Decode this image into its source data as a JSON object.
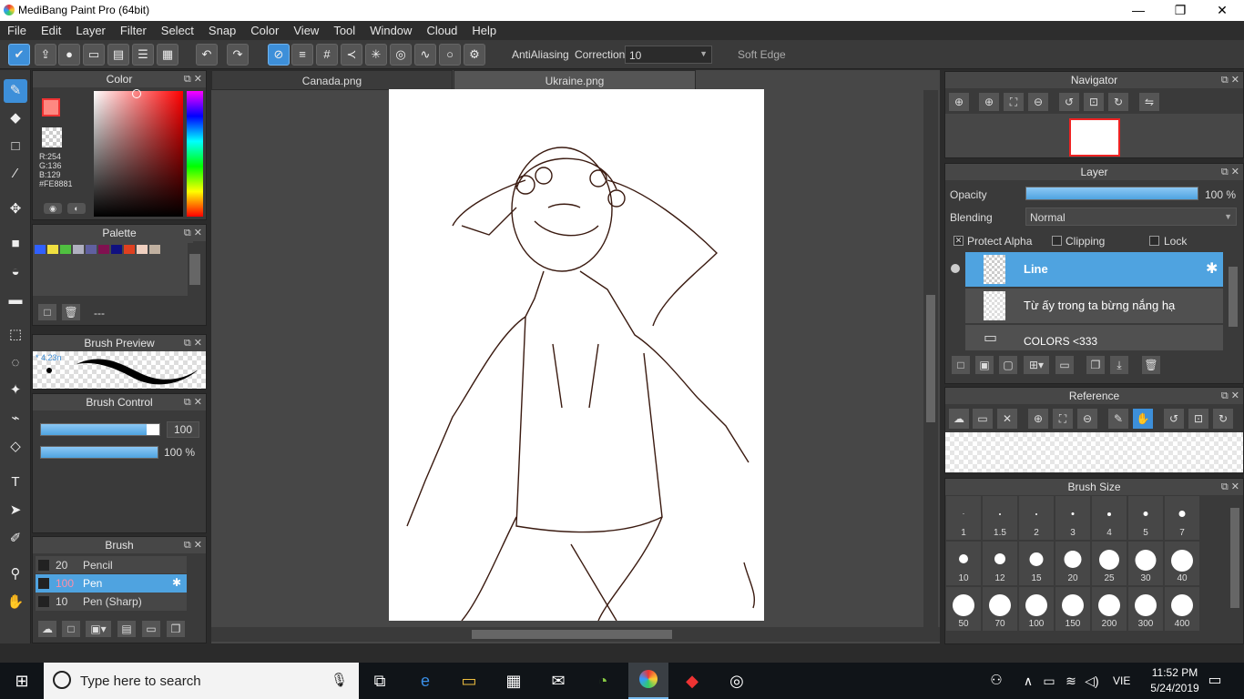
{
  "window": {
    "title": "MediBang Paint Pro (64bit)",
    "minimize": "—",
    "restore": "❐",
    "close": "✕"
  },
  "menu": [
    "File",
    "Edit",
    "Layer",
    "Filter",
    "Select",
    "Snap",
    "Color",
    "View",
    "Tool",
    "Window",
    "Cloud",
    "Help"
  ],
  "toolbar": {
    "antialiasing_label": "AntiAliasing",
    "antialiasing_checked": "✕",
    "correction_label": "Correction",
    "correction_value": "10",
    "soft_edge_label": "Soft Edge"
  },
  "color_panel": {
    "title": "Color",
    "r": "R:254",
    "g": "G:136",
    "b": "B:129",
    "hex": "#FE8881",
    "primary": "#fe8881",
    "secondary": "#fe8881"
  },
  "palette": {
    "title": "Palette",
    "colors": [
      "#3060ff",
      "#f0e040",
      "#50c040",
      "#b0b0c0",
      "#6060a0",
      "#801050",
      "#101080",
      "#e04020",
      "#f0d0c0",
      "#c0b0a0"
    ],
    "value": "---"
  },
  "brush_preview": {
    "title": "Brush Preview",
    "size": "* 4.23n"
  },
  "brush_control": {
    "title": "Brush Control",
    "size_value": "100",
    "opacity_value": "100 %"
  },
  "brush": {
    "title": "Brush",
    "items": [
      {
        "size": "20",
        "name": "Pencil"
      },
      {
        "size": "100",
        "name": "Pen"
      },
      {
        "size": "10",
        "name": "Pen (Sharp)"
      }
    ]
  },
  "tabs": [
    "Canada.png",
    "Ukraine.png"
  ],
  "navigator": {
    "title": "Navigator"
  },
  "layer": {
    "title": "Layer",
    "opacity_label": "Opacity",
    "opacity_value": "100 %",
    "opacity_fraction": 1.0,
    "blending_label": "Blending",
    "blending_value": "Normal",
    "protect_alpha": "Protect Alpha",
    "clipping": "Clipping",
    "lock": "Lock",
    "layers": [
      "Line",
      "Từ ấy trong ta bừng nắng hạ",
      "COLORS <333"
    ]
  },
  "reference": {
    "title": "Reference"
  },
  "brush_size": {
    "title": "Brush Size",
    "sizes": [
      "1",
      "1.5",
      "2",
      "3",
      "4",
      "5",
      "7",
      "10",
      "12",
      "15",
      "20",
      "25",
      "30",
      "40",
      "50",
      "70",
      "100",
      "150",
      "200",
      "300",
      "400"
    ]
  },
  "taskbar": {
    "search_placeholder": "Type here to search",
    "language": "VIE",
    "time": "11:52 PM",
    "date": "5/24/2019"
  }
}
